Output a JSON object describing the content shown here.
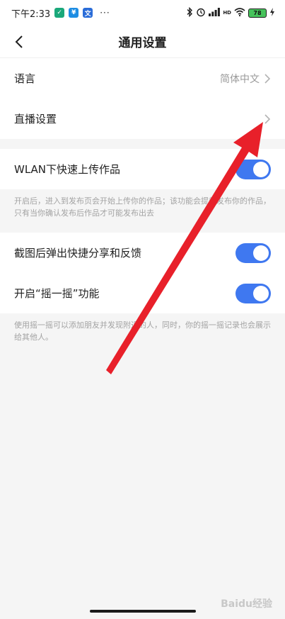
{
  "status_bar": {
    "time": "下午2:33",
    "apps": [
      "shield-app-icon",
      "alipay-icon",
      "tv-app-icon"
    ],
    "more": "···",
    "network": "HD",
    "battery": "78"
  },
  "header": {
    "title": "通用设置"
  },
  "settings": {
    "language": {
      "label": "语言",
      "value": "简体中文"
    },
    "live": {
      "label": "直播设置"
    },
    "wlan_upload": {
      "label": "WLAN下快速上传作品",
      "enabled": true
    },
    "wlan_note": "开启后，进入到发布页会开始上传你的作品；该功能会提前发布你的作品，只有当你确认发布后作品才可能发布出去",
    "screenshot_share": {
      "label": "截图后弹出快捷分享和反馈",
      "enabled": true
    },
    "shake": {
      "label": "开启“摇一摇”功能",
      "enabled": true
    },
    "shake_note": "使用摇一摇可以添加朋友并发现附近的人，同时，你的摇一摇记录也会展示给其他人。"
  },
  "colors": {
    "toggle_on": "#3f78f0",
    "annotation_arrow": "#e8202a"
  },
  "watermark": "Baidu经验"
}
